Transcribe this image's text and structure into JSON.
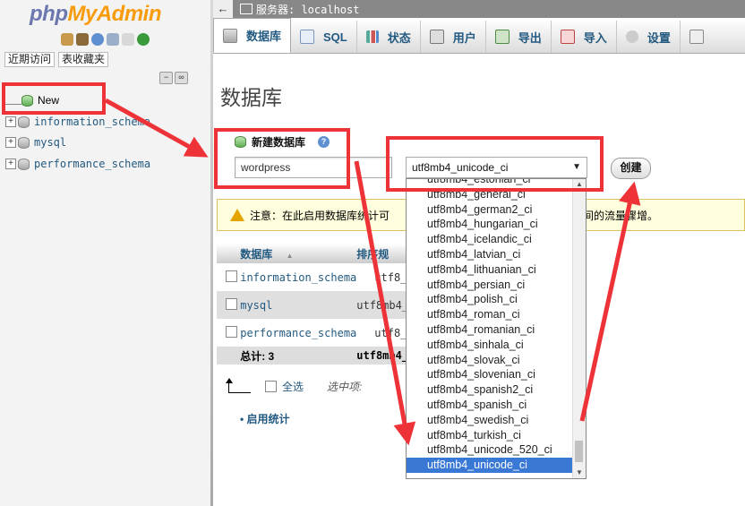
{
  "logo": {
    "part1": "php",
    "part2": "MyAdmin"
  },
  "nav": {
    "tabs": [
      "近期访问",
      "表收藏夹"
    ],
    "tree": [
      {
        "label": "New"
      },
      {
        "label": "information_schema"
      },
      {
        "label": "mysql"
      },
      {
        "label": "performance_schema"
      }
    ]
  },
  "breadcrumb": {
    "server": "服务器: localhost"
  },
  "tabs": [
    "数据库",
    "SQL",
    "状态",
    "用户",
    "导出",
    "导入",
    "设置"
  ],
  "page": {
    "title": "数据库",
    "create_label": "新建数据库",
    "db_name_value": "wordpress",
    "collation_value": "utf8mb4_unicode_ci",
    "create_button": "创建",
    "notice": "注意：在此启用数据库统计可能导致网站服务器和 MySQL 服务器之间的流量骤增。",
    "notice_visible_left": "注意：在此启用数据库统计可",
    "notice_visible_right": "之间的流量骤增。",
    "table": {
      "headers": [
        "数据库",
        "排序规"
      ],
      "rows": [
        {
          "name": "information_schema",
          "collation": "utf8_"
        },
        {
          "name": "mysql",
          "collation": "utf8mb4_"
        },
        {
          "name": "performance_schema",
          "collation": "utf8_"
        }
      ],
      "total_label": "总计: 3",
      "total_collation": "utf8mb4_"
    },
    "check_all": "全选",
    "with_selected": "选中项:",
    "enable_stats": "启用统计"
  },
  "collation_options": [
    "utf8mb4_estonian_ci",
    "utf8mb4_general_ci",
    "utf8mb4_german2_ci",
    "utf8mb4_hungarian_ci",
    "utf8mb4_icelandic_ci",
    "utf8mb4_latvian_ci",
    "utf8mb4_lithuanian_ci",
    "utf8mb4_persian_ci",
    "utf8mb4_polish_ci",
    "utf8mb4_roman_ci",
    "utf8mb4_romanian_ci",
    "utf8mb4_sinhala_ci",
    "utf8mb4_slovak_ci",
    "utf8mb4_slovenian_ci",
    "utf8mb4_spanish2_ci",
    "utf8mb4_spanish_ci",
    "utf8mb4_swedish_ci",
    "utf8mb4_turkish_ci",
    "utf8mb4_unicode_520_ci",
    "utf8mb4_unicode_ci"
  ],
  "selected_option": "utf8mb4_unicode_ci",
  "colors": {
    "annotation": "#ee3338",
    "link": "#235a81",
    "selected": "#3a78d6"
  }
}
